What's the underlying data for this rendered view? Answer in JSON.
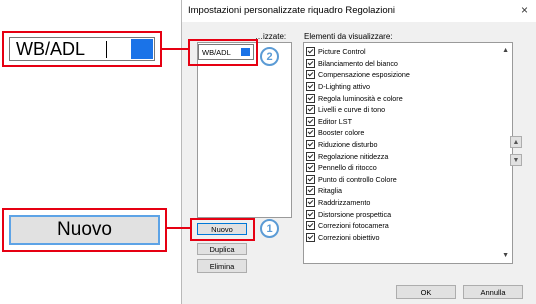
{
  "dialog": {
    "title": "Impostazioni personalizzate riquadro Regolazioni",
    "close_glyph": "×",
    "left_label": "…izzate:",
    "right_label": "Elementi da visualizzare:",
    "items": [
      "Picture Control",
      "Bilanciamento del bianco",
      "Compensazione esposizione",
      "D-Lighting attivo",
      "Regola luminosità e colore",
      "Livelli e curve di tono",
      "Editor LST",
      "Booster colore",
      "Riduzione disturbo",
      "Regolazione nitidezza",
      "Pennello di ritocco",
      "Punto di controllo Colore",
      "Ritaglia",
      "Raddrizzamento",
      "Distorsione prospettica",
      "Correzioni fotocamera",
      "Correzioni obiettivo"
    ],
    "buttons": {
      "new": "Nuovo",
      "duplicate": "Duplica",
      "delete": "Elimina",
      "ok": "OK",
      "cancel": "Annulla",
      "move_up": "▲",
      "move_down": "▼"
    },
    "field_value": "WB/ADL"
  },
  "callouts": {
    "zoom_text_value": "WB/ADL",
    "zoom_button_label": "Nuovo",
    "step1": "1",
    "step2": "2"
  },
  "colors": {
    "highlight": "#e60012",
    "callout_circle": "#5b9bd5",
    "selection": "#1a73e8"
  }
}
